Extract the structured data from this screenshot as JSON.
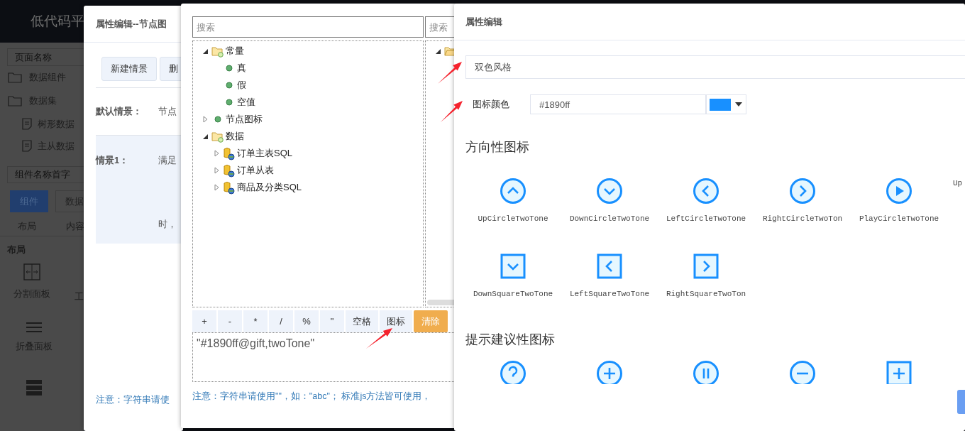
{
  "app": {
    "title": "低代码平",
    "page_search": {
      "placeholder": "页面名称"
    },
    "tree": [
      {
        "label": "数据组件",
        "kind": "folder"
      },
      {
        "label": "数据集",
        "kind": "folder",
        "children": [
          {
            "label": "树形数据",
            "kind": "doc"
          },
          {
            "label": "主从数据",
            "kind": "doc"
          }
        ]
      }
    ],
    "component_search": {
      "placeholder": "组件名称首字"
    },
    "tabs": [
      {
        "label": "组件",
        "selected": true
      },
      {
        "label": "数据",
        "selected": false
      }
    ],
    "subtabs": [
      "布局",
      "内容"
    ],
    "section": "布局",
    "tiles": [
      {
        "label": "分割面板",
        "kind": "split",
        "peek": "工"
      },
      {
        "label": "折叠面板",
        "kind": "lines"
      },
      {
        "kind": "stack"
      }
    ]
  },
  "dialog_scenes": {
    "title": "属性编辑--节点图",
    "buttons": [
      "新建情景",
      "删"
    ],
    "default_label": "默认情景：",
    "default_value": "节点",
    "scenarios": [
      {
        "label": "情景1：",
        "lines": [
          "满足",
          "时，"
        ]
      }
    ],
    "note": "注意：字符串请使"
  },
  "dialog_expression": {
    "search_left": {
      "placeholder": "搜索"
    },
    "search_right": {
      "placeholder": "搜索"
    },
    "tree": [
      {
        "label": "常量",
        "kind": "folder",
        "expanded": true,
        "children": [
          {
            "label": "真",
            "kind": "dot"
          },
          {
            "label": "假",
            "kind": "dot"
          },
          {
            "label": "空值",
            "kind": "dot"
          }
        ]
      },
      {
        "label": "节点图标",
        "kind": "dot",
        "expanded": false
      },
      {
        "label": "数据",
        "kind": "folder",
        "expanded": true,
        "children": [
          {
            "label": "订单主表SQL",
            "kind": "db",
            "expanded": false
          },
          {
            "label": "订单从表",
            "kind": "db",
            "expanded": false
          },
          {
            "label": "商品及分类SQL",
            "kind": "db",
            "expanded": false
          }
        ]
      }
    ],
    "right_tree": [
      {
        "kind": "folder-open",
        "expanded": true
      }
    ],
    "buttons": [
      {
        "label": "+",
        "kind": "op"
      },
      {
        "label": "-",
        "kind": "op"
      },
      {
        "label": "*",
        "kind": "op"
      },
      {
        "label": "/",
        "kind": "op"
      },
      {
        "label": "%",
        "kind": "op"
      },
      {
        "label": "\"",
        "kind": "op"
      },
      {
        "label": "空格",
        "kind": "wide"
      },
      {
        "label": "图标",
        "kind": "wide"
      },
      {
        "label": "清除",
        "kind": "clear"
      }
    ],
    "expression": "\"#1890ff@gift,twoTone\"",
    "note": "注意：字符串请使用\"\"，如：\"abc\"；  标准js方法皆可使用，"
  },
  "dialog_icons": {
    "title": "属性编辑",
    "style_field": {
      "value": "双色风格"
    },
    "color_field": {
      "label": "图标颜色",
      "value": "#1890ff",
      "color": "#1890ff"
    },
    "sections": [
      {
        "title": "方向性图标",
        "icons": [
          {
            "label": "UpCircleTwoTone",
            "kind": "circle-up"
          },
          {
            "label": "DownCircleTwoTone",
            "kind": "circle-down"
          },
          {
            "label": "LeftCircleTwoTone",
            "kind": "circle-left"
          },
          {
            "label": "RightCircleTwoTon",
            "kind": "circle-right"
          },
          {
            "label": "PlayCircleTwoTone",
            "kind": "circle-play"
          },
          {
            "label": "Up"
          },
          {
            "label": "DownSquareTwoTone",
            "kind": "square-down"
          },
          {
            "label": "LeftSquareTwoTone",
            "kind": "square-left"
          },
          {
            "label": "RightSquareTwoTon",
            "kind": "square-right"
          }
        ]
      },
      {
        "title": "提示建议性图标",
        "icons": [
          {
            "kind": "circle-question"
          },
          {
            "kind": "circle-plus"
          },
          {
            "kind": "circle-pause"
          },
          {
            "kind": "circle-minus"
          },
          {
            "kind": "square-plus"
          }
        ]
      }
    ]
  }
}
